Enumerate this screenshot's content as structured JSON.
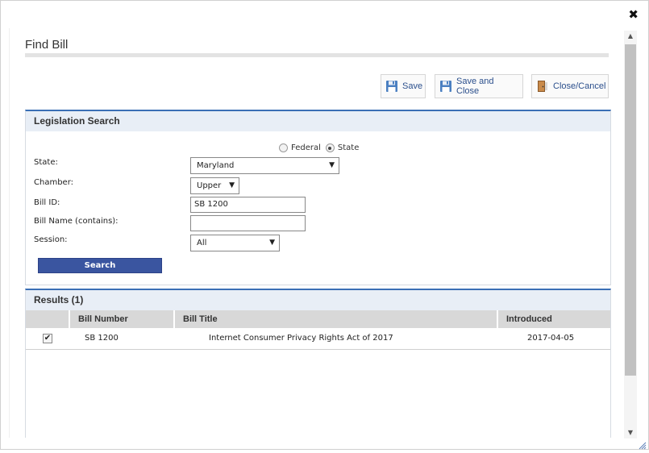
{
  "dialog": {
    "title": "Find Bill",
    "close_glyph": "✖"
  },
  "toolbar": {
    "save_label": "Save",
    "save_close_label": "Save and Close",
    "close_cancel_label": "Close/Cancel"
  },
  "search": {
    "header": "Legislation Search",
    "scope_options": [
      {
        "label": "Federal",
        "checked": false
      },
      {
        "label": "State",
        "checked": true
      }
    ],
    "state_label": "State:",
    "state_value": "Maryland",
    "chamber_label": "Chamber:",
    "chamber_value": "Upper",
    "bill_id_label": "Bill ID:",
    "bill_id_value": "SB 1200",
    "bill_name_label": "Bill Name (contains):",
    "bill_name_value": "",
    "session_label": "Session:",
    "session_value": "All",
    "search_button": "Search"
  },
  "results": {
    "header": "Results (1)",
    "columns": [
      "Bill Number",
      "Bill Title",
      "Introduced"
    ],
    "rows": [
      {
        "checked": true,
        "bill_number": "SB 1200",
        "bill_title": "Internet Consumer Privacy Rights Act of 2017",
        "introduced": "2017-04-05"
      }
    ]
  },
  "icons": {
    "save": "floppy-disk-icon",
    "save_close": "floppy-disk-icon",
    "close_cancel": "door-exit-icon",
    "dropdown": "caret-down-icon"
  },
  "colors": {
    "accent": "#3a6fb5",
    "button_primary": "#3a55a0",
    "link_text": "#2b4f8c",
    "section_header_bg": "#e8eef6"
  }
}
